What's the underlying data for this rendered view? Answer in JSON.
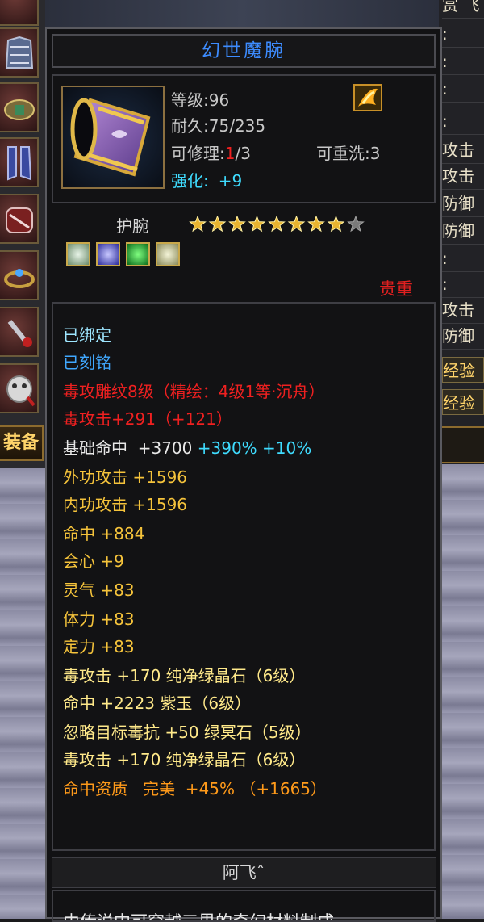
{
  "left_panel": {
    "equip_tab_label": "装备"
  },
  "right_panel": {
    "rows": [
      "赏 飞",
      ":",
      ":",
      ":",
      ":",
      "攻击",
      "攻击",
      "防御",
      "防御",
      ":",
      ":",
      "攻击",
      "防御"
    ],
    "buttons": [
      "经验",
      "经验"
    ]
  },
  "tooltip": {
    "title": "幻世魔腕",
    "level": "等级:96",
    "durability": {
      "label": "耐久:",
      "value": "75/235"
    },
    "repair": {
      "label": "可修理:",
      "current": "1",
      "total": "/3"
    },
    "rewash": "可重洗:3",
    "enhance": {
      "label": "强化:",
      "value": "+9"
    },
    "category": "护腕",
    "stars": {
      "filled": 8,
      "total": 9
    },
    "gems": [
      "white-gem",
      "blue-gem",
      "green-gem",
      "white-gem"
    ],
    "quality": "贵重",
    "bound": "已绑定",
    "engraved": "已刻铭",
    "attributes": {
      "carve": "毒攻雕纹8级（精绘：4级1等·沉舟）",
      "poison_atk": {
        "label": "毒攻击+291",
        "bonus": "（+121）"
      },
      "base_hit": {
        "label": "基础命中",
        "value": "+3700",
        "pct1": "+390%",
        "pct2": "+10%"
      },
      "outer_atk": "外功攻击  +1596",
      "inner_atk": "内功攻击  +1596",
      "hit": "命中  +884",
      "crit": "会心  +9",
      "spirit": "灵气  +83",
      "stamina": "体力  +83",
      "focus": "定力  +83",
      "gem_lines": [
        "毒攻击  +170  纯净绿晶石（6级）",
        "命中  +2223  紫玉（6级）",
        "忽略目标毒抗  +50  绿冥石（5级）",
        "毒攻击  +170  纯净绿晶石（6级）"
      ],
      "aptitude": {
        "label": "命中资质",
        "grade": "完美",
        "pct": "+45%",
        "bonus": "（+1665）"
      }
    },
    "owner": "阿飞ˆ",
    "description": "由传说中可穿越三界的奇幻材料制成，"
  },
  "colors": {
    "title": "#3d8cff",
    "quality": "#e02020",
    "bound": "#9ee6ff",
    "carve": "#f02020",
    "base_stat": "#f5c33b",
    "gem_line": "#ffe98a",
    "aptitude": "#ff9a1a"
  }
}
